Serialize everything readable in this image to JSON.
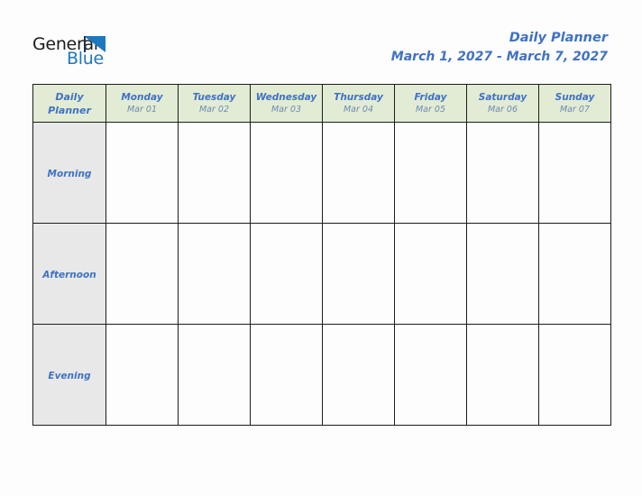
{
  "brand": {
    "name_part1": "General",
    "name_part2": "Blue",
    "mark": "triangle-icon",
    "color_dark": "#1b1b1b",
    "color_blue": "#1b79bf"
  },
  "header": {
    "title": "Daily Planner",
    "date_range": "March 1, 2027 - March 7, 2027",
    "accent_color": "#3f72c4"
  },
  "table": {
    "corner": {
      "line1": "Daily",
      "line2": "Planner"
    },
    "header_bg": "#e2ecd4",
    "row_label_bg": "#e8e8e8",
    "border_color": "#1c1c1c",
    "columns": [
      {
        "day": "Monday",
        "date": "Mar 01"
      },
      {
        "day": "Tuesday",
        "date": "Mar 02"
      },
      {
        "day": "Wednesday",
        "date": "Mar 03"
      },
      {
        "day": "Thursday",
        "date": "Mar 04"
      },
      {
        "day": "Friday",
        "date": "Mar 05"
      },
      {
        "day": "Saturday",
        "date": "Mar 06"
      },
      {
        "day": "Sunday",
        "date": "Mar 07"
      }
    ],
    "rows": [
      {
        "label": "Morning",
        "cells": [
          "",
          "",
          "",
          "",
          "",
          "",
          ""
        ]
      },
      {
        "label": "Afternoon",
        "cells": [
          "",
          "",
          "",
          "",
          "",
          "",
          ""
        ]
      },
      {
        "label": "Evening",
        "cells": [
          "",
          "",
          "",
          "",
          "",
          "",
          ""
        ]
      }
    ]
  }
}
